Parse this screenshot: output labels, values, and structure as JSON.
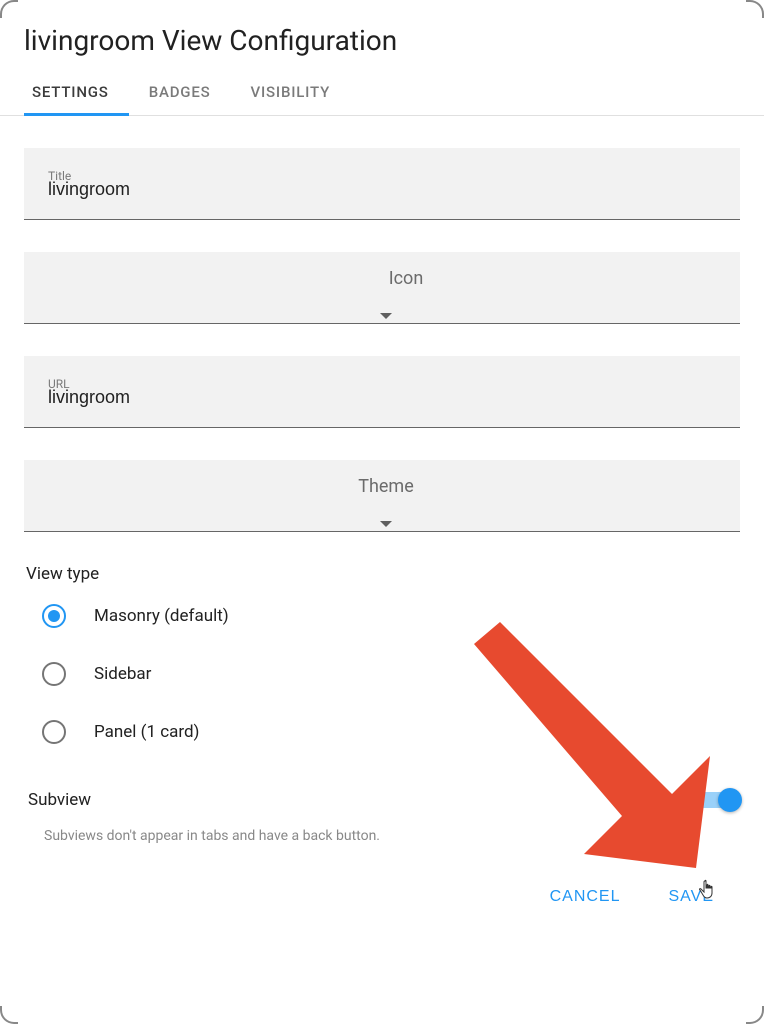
{
  "dialog": {
    "title": "livingroom View Configuration"
  },
  "tabs": [
    {
      "label": "SETTINGS",
      "active": true
    },
    {
      "label": "BADGES",
      "active": false
    },
    {
      "label": "VISIBILITY",
      "active": false
    }
  ],
  "fields": {
    "title": {
      "label": "Title",
      "value": "livingroom"
    },
    "icon": {
      "label": "Icon",
      "value": ""
    },
    "url": {
      "label": "URL",
      "value": "livingroom"
    },
    "theme": {
      "label": "Theme",
      "value": ""
    }
  },
  "view_type": {
    "label": "View type",
    "options": [
      {
        "label": "Masonry (default)",
        "checked": true
      },
      {
        "label": "Sidebar",
        "checked": false
      },
      {
        "label": "Panel (1 card)",
        "checked": false
      }
    ]
  },
  "subview": {
    "label": "Subview",
    "helper": "Subviews don't appear in tabs and have a back button.",
    "enabled": true
  },
  "actions": {
    "cancel": "CANCEL",
    "save": "SAVE"
  }
}
